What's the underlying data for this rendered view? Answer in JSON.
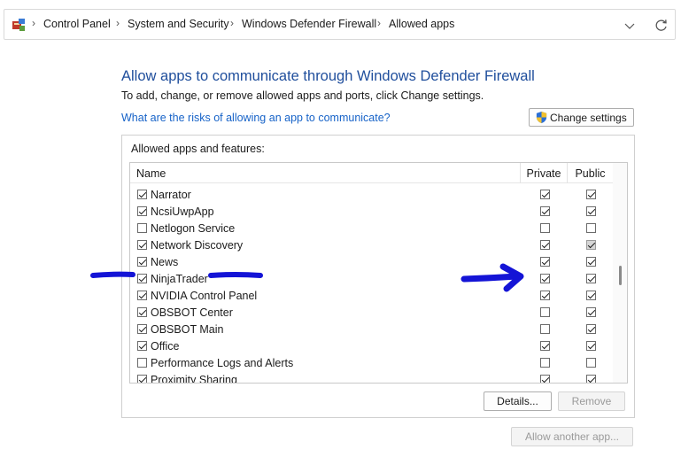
{
  "address_bar": {
    "icon": "control-panel-icon",
    "breadcrumbs": [
      "Control Panel",
      "System and Security",
      "Windows Defender Firewall",
      "Allowed apps"
    ]
  },
  "header": {
    "title": "Allow apps to communicate through Windows Defender Firewall",
    "subtitle": "To add, change, or remove allowed apps and ports, click Change settings.",
    "risk_link": "What are the risks of allowing an app to communicate?",
    "change_settings": "Change settings"
  },
  "apps_group": {
    "label": "Allowed apps and features:",
    "columns": {
      "name": "Name",
      "private": "Private",
      "public": "Public"
    },
    "rows": [
      {
        "name": "Narrator",
        "enabled": true,
        "private": true,
        "public": true
      },
      {
        "name": "NcsiUwpApp",
        "enabled": true,
        "private": true,
        "public": true
      },
      {
        "name": "Netlogon Service",
        "enabled": false,
        "private": false,
        "public": false
      },
      {
        "name": "Network Discovery",
        "enabled": true,
        "private": true,
        "public": true
      },
      {
        "name": "News",
        "enabled": true,
        "private": true,
        "public": true
      },
      {
        "name": "NinjaTrader",
        "enabled": true,
        "private": true,
        "public": true
      },
      {
        "name": "NVIDIA Control Panel",
        "enabled": true,
        "private": true,
        "public": true
      },
      {
        "name": "OBSBOT Center",
        "enabled": true,
        "private": false,
        "public": true
      },
      {
        "name": "OBSBOT Main",
        "enabled": true,
        "private": false,
        "public": true
      },
      {
        "name": "Office",
        "enabled": true,
        "private": true,
        "public": true
      },
      {
        "name": "Performance Logs and Alerts",
        "enabled": false,
        "private": false,
        "public": false
      },
      {
        "name": "Proximity Sharing",
        "enabled": true,
        "private": true,
        "public": true
      }
    ]
  },
  "buttons": {
    "details": "Details...",
    "remove": "Remove",
    "allow_another": "Allow another app..."
  },
  "colors": {
    "title": "#1f4e9c",
    "link": "#1763c8",
    "annotation": "#1414d6"
  }
}
